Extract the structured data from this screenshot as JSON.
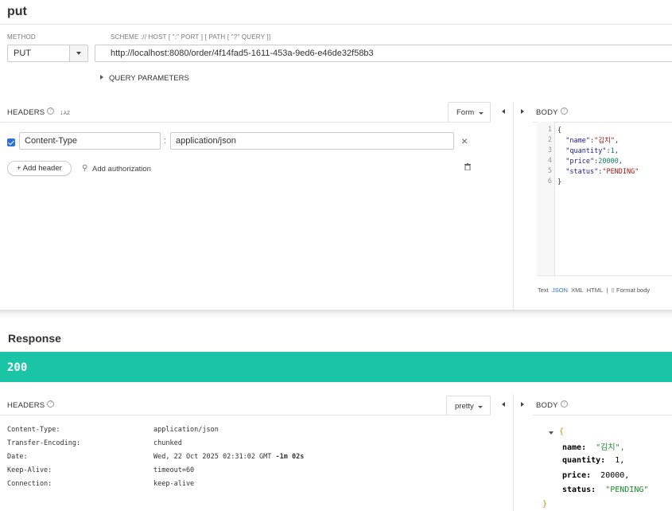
{
  "request": {
    "title": "put",
    "method_label": "METHOD",
    "scheme_label": "SCHEME :// HOST [ \":\" PORT ] [ PATH [ \"?\" QUERY ]]",
    "method": "PUT",
    "url": "http://localhost:8080/order/4f14fad5-1611-453a-9ed6-e46de32f58b3",
    "query_params_label": "QUERY PARAMETERS",
    "headers_label": "HEADERS",
    "form_label": "Form",
    "header_row": {
      "name": "Content-Type",
      "separator": ":",
      "value": "application/json"
    },
    "add_header_label": "+ Add header",
    "add_auth_label": "Add authorization",
    "body_label": "BODY",
    "body_lines": {
      "l1": "{",
      "l2_key": "\"name\"",
      "l2_val": "\"김치\"",
      "l3_key": "\"quantity\"",
      "l3_val": "1",
      "l4_key": "\"price\"",
      "l4_val": "20000",
      "l5_key": "\"status\"",
      "l5_val": "\"PENDING\"",
      "l6": "}"
    },
    "line_numbers": [
      "1",
      "2",
      "3",
      "4",
      "5",
      "6"
    ],
    "formats": {
      "text": "Text",
      "json": "JSON",
      "xml": "XML",
      "html": "HTML",
      "sep": "|",
      "format_body": "Format body"
    }
  },
  "response": {
    "title": "Response",
    "status": "200",
    "headers_label": "HEADERS",
    "pretty_label": "pretty",
    "body_label": "BODY",
    "headers": [
      {
        "name": "Content-Type:",
        "value": "application/json"
      },
      {
        "name": "Transfer-Encoding:",
        "value": "chunked"
      },
      {
        "name": "Date:",
        "value": "Wed, 22 Oct 2025 02:31:02 GMT",
        "extra": "-1m 02s"
      },
      {
        "name": "Keep-Alive:",
        "value": "timeout=60"
      },
      {
        "name": "Connection:",
        "value": "keep-alive"
      }
    ],
    "body": {
      "open": "{",
      "close": "}",
      "name_key": "name:",
      "name_val": "\"김치\",",
      "quantity_key": "quantity:",
      "quantity_val": "1,",
      "price_key": "price:",
      "price_val": "20000,",
      "status_key": "status:",
      "status_val": "\"PENDING\""
    }
  },
  "colors": {
    "status_bar": "#19c5a4",
    "accent": "#2a6fdb"
  }
}
